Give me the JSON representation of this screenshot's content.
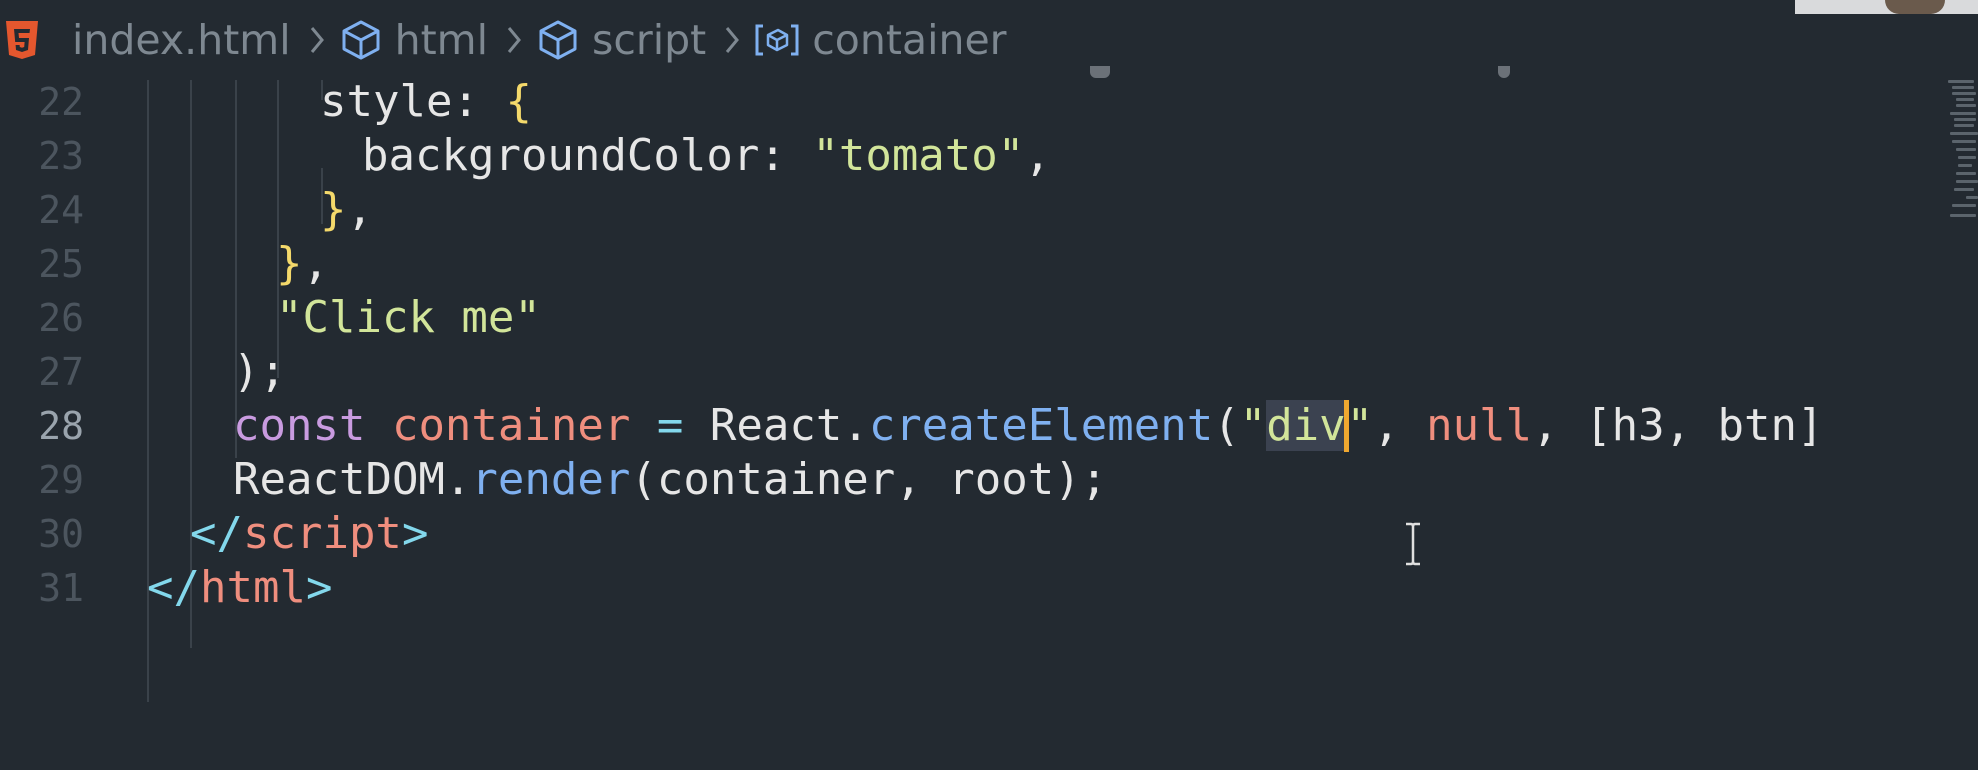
{
  "breadcrumb": {
    "file": "index.html",
    "items": [
      "html",
      "script",
      "container"
    ]
  },
  "code_lines": [
    {
      "n": "22",
      "tokens": [
        [
          "prop",
          "style"
        ],
        [
          "punc",
          ": "
        ],
        [
          "brace",
          "{"
        ]
      ]
    },
    {
      "n": "23",
      "tokens": [
        [
          "prop",
          "backgroundColor"
        ],
        [
          "punc",
          ": "
        ],
        [
          "str",
          "\"tomato\""
        ],
        [
          "punc",
          ","
        ]
      ]
    },
    {
      "n": "24",
      "tokens": [
        [
          "brace",
          "}"
        ],
        [
          "punc",
          ","
        ]
      ]
    },
    {
      "n": "25",
      "tokens": [
        [
          "brace",
          "}"
        ],
        [
          "punc",
          ","
        ]
      ]
    },
    {
      "n": "26",
      "tokens": [
        [
          "str",
          "\"Click me\""
        ]
      ]
    },
    {
      "n": "27",
      "tokens": [
        [
          "punc",
          ");"
        ]
      ]
    },
    {
      "n": "28",
      "tokens": [
        [
          "kw",
          "const"
        ],
        [
          "punc",
          " "
        ],
        [
          "var",
          "container"
        ],
        [
          "punc",
          " "
        ],
        [
          "op",
          "="
        ],
        [
          "punc",
          " React."
        ],
        [
          "fn",
          "createElement"
        ],
        [
          "punc",
          "("
        ],
        [
          "str",
          "\""
        ],
        [
          "sel",
          "div"
        ],
        [
          "cursor",
          ""
        ],
        [
          "str",
          "\""
        ],
        [
          "punc",
          ", "
        ],
        [
          "null",
          "null"
        ],
        [
          "punc",
          ", [h3, btn]"
        ]
      ]
    },
    {
      "n": "29",
      "tokens": [
        [
          "punc",
          "ReactDOM."
        ],
        [
          "fn",
          "render"
        ],
        [
          "punc",
          "(container, root);"
        ]
      ]
    },
    {
      "n": "30",
      "tokens": [
        [
          "tagp",
          "</"
        ],
        [
          "tag",
          "script"
        ],
        [
          "tagp",
          ">"
        ]
      ]
    },
    {
      "n": "31",
      "tokens": [
        [
          "tagp",
          "</"
        ],
        [
          "tag",
          "html"
        ],
        [
          "tagp",
          ">"
        ]
      ]
    }
  ],
  "active_line": "28",
  "colors": {
    "background": "#232a31",
    "string": "#d2e59a",
    "keyword": "#c99be0",
    "variable": "#ef8e7e",
    "function": "#7fb0f0",
    "operator": "#83d8ec",
    "cursor": "#f0a830"
  },
  "icons": {
    "file": "html5-icon",
    "html": "cube-icon",
    "script": "cube-icon",
    "container": "variable-icon",
    "separator": "chevron-right-icon"
  }
}
